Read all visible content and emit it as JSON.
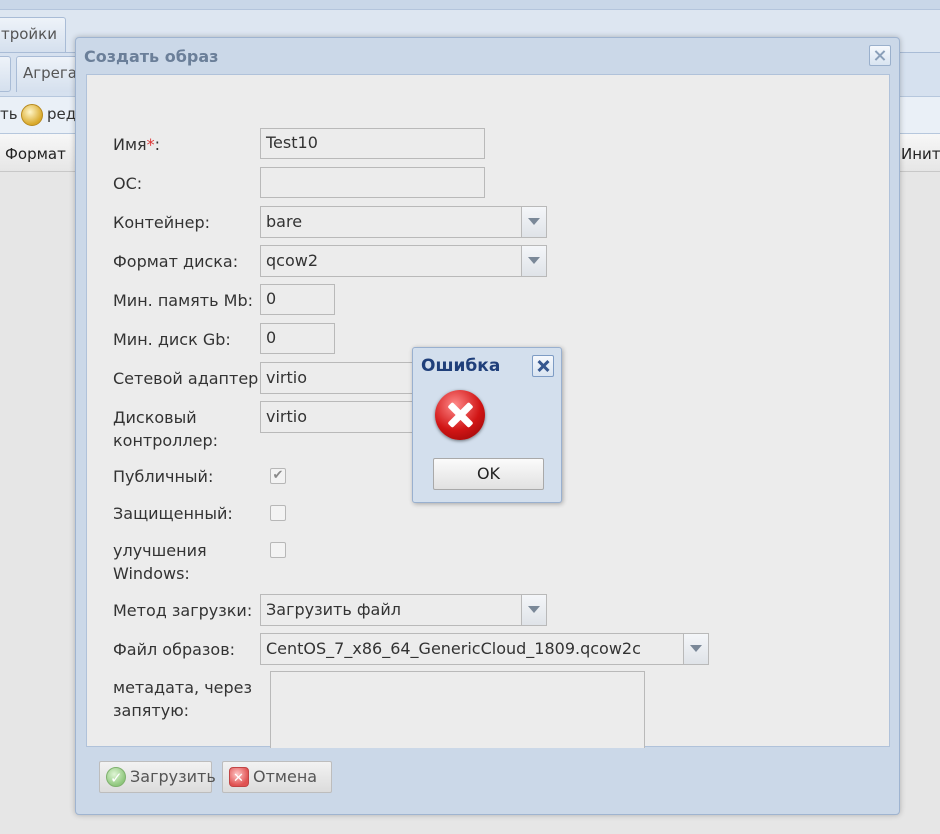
{
  "background": {
    "tab_settings": "тройки",
    "tab_aggregates": "Агрега",
    "toolbar_left": "ть",
    "toolbar_edit": "ред",
    "column_format": "Формат",
    "column_right": "Инит"
  },
  "dialog": {
    "title": "Создать образ",
    "fields": {
      "name_label": "Имя",
      "name_required": "*",
      "name_label_colon": ":",
      "name_value": "Test10",
      "os_label": "ОС:",
      "os_value": "",
      "container_label": "Контейнер:",
      "container_value": "bare",
      "disk_format_label": "Формат диска:",
      "disk_format_value": "qcow2",
      "min_ram_label": "Мин. память Mb:",
      "min_ram_value": "0",
      "min_disk_label": "Мин. диск Gb:",
      "min_disk_value": "0",
      "net_adapter_label": "Сетевой адаптер:",
      "net_adapter_value": "virtio",
      "disk_ctrl_label_1": "Дисковый",
      "disk_ctrl_label_2": "контроллер:",
      "disk_ctrl_value": "virtio",
      "public_label": "Публичный:",
      "public_checked": true,
      "protected_label": "Защищенный:",
      "protected_checked": false,
      "win_label_1": "улучшения",
      "win_label_2": "Windows:",
      "win_checked": false,
      "upload_method_label": "Метод загрузки:",
      "upload_method_value": "Загрузить файл",
      "image_file_label": "Файл образов:",
      "image_file_value": "CentOS_7_x86_64_GenericCloud_1809.qcow2c",
      "metadata_label_1": "метадата, через",
      "metadata_label_2": "запятую:",
      "metadata_value": ""
    },
    "buttons": {
      "upload": "Загрузить",
      "cancel": "Отмена"
    }
  },
  "error_popup": {
    "title": "Ошибка",
    "ok": "OK"
  }
}
